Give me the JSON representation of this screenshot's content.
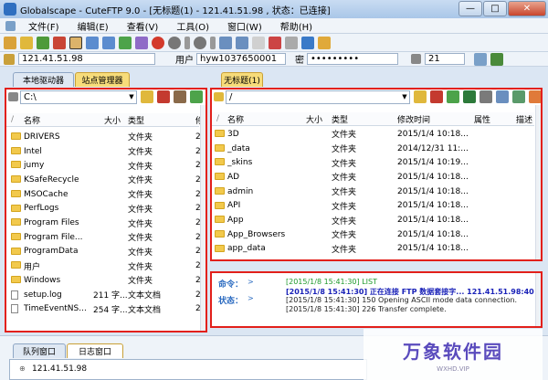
{
  "window": {
    "title": "Globalscape - CuteFTP 9.0 - [无标题(1) - 121.41.51.98 , 状态：已连接]",
    "min": "—",
    "max": "□",
    "close": "✕"
  },
  "menu": [
    "文件(F)",
    "编辑(E)",
    "查看(V)",
    "工具(O)",
    "窗口(W)",
    "帮助(H)"
  ],
  "connection": {
    "host_value": "121.41.51.98",
    "user_label": "用户",
    "user_value": "hyw1037650001",
    "pass_label": "密",
    "pass_value": "•••••••••",
    "port_value": "21"
  },
  "left_tabs": [
    "本地驱动器",
    "站点管理器"
  ],
  "right_tab": "无标题(1)",
  "local": {
    "path": "C:\\",
    "columns": [
      "名称",
      "大小",
      "类型",
      "修"
    ],
    "rows": [
      {
        "name": "DRIVERS",
        "size": "",
        "type": "文件夹",
        "mod": "2",
        "kind": "folder"
      },
      {
        "name": "Intel",
        "size": "",
        "type": "文件夹",
        "mod": "2",
        "kind": "folder"
      },
      {
        "name": "jumy",
        "size": "",
        "type": "文件夹",
        "mod": "2",
        "kind": "folder"
      },
      {
        "name": "KSafeRecycle",
        "size": "",
        "type": "文件夹",
        "mod": "2",
        "kind": "folder"
      },
      {
        "name": "MSOCache",
        "size": "",
        "type": "文件夹",
        "mod": "2",
        "kind": "folder"
      },
      {
        "name": "PerfLogs",
        "size": "",
        "type": "文件夹",
        "mod": "2",
        "kind": "folder"
      },
      {
        "name": "Program Files",
        "size": "",
        "type": "文件夹",
        "mod": "2",
        "kind": "folder"
      },
      {
        "name": "Program File...",
        "size": "",
        "type": "文件夹",
        "mod": "2",
        "kind": "folder"
      },
      {
        "name": "ProgramData",
        "size": "",
        "type": "文件夹",
        "mod": "2",
        "kind": "folder"
      },
      {
        "name": "用户",
        "size": "",
        "type": "文件夹",
        "mod": "2",
        "kind": "folder"
      },
      {
        "name": "Windows",
        "size": "",
        "type": "文件夹",
        "mod": "2",
        "kind": "folder"
      },
      {
        "name": "setup.log",
        "size": "211 字...",
        "type": "文本文档",
        "mod": "2",
        "kind": "file"
      },
      {
        "name": "TimeEventNS...",
        "size": "254 字...",
        "type": "文本文档",
        "mod": "2",
        "kind": "file"
      }
    ]
  },
  "remote": {
    "path": "/",
    "columns": [
      "名称",
      "大小",
      "类型",
      "修改时间",
      "属性",
      "描述"
    ],
    "rows": [
      {
        "name": "3D",
        "type": "文件夹",
        "mod": "2015/1/4 10:18..."
      },
      {
        "name": "_data",
        "type": "文件夹",
        "mod": "2014/12/31 11:..."
      },
      {
        "name": "_skins",
        "type": "文件夹",
        "mod": "2015/1/4 10:19..."
      },
      {
        "name": "AD",
        "type": "文件夹",
        "mod": "2015/1/4 10:18..."
      },
      {
        "name": "admin",
        "type": "文件夹",
        "mod": "2015/1/4 10:18..."
      },
      {
        "name": "API",
        "type": "文件夹",
        "mod": "2015/1/4 10:18..."
      },
      {
        "name": "App",
        "type": "文件夹",
        "mod": "2015/1/4 10:18..."
      },
      {
        "name": "App_Browsers",
        "type": "文件夹",
        "mod": "2015/1/4 10:18..."
      },
      {
        "name": "app_data",
        "type": "文件夹",
        "mod": "2015/1/4 10:18..."
      }
    ]
  },
  "log": {
    "cmd_label": "命令：",
    "cmd_arrow": ">",
    "status_label": "状态：",
    "status_arrow": ">",
    "lines": [
      {
        "text": "[2015/1/8 15:41:30] LIST",
        "color": "#1e9a2c"
      },
      {
        "text": "[2015/1/8 15:41:30] 正在连接 FTP 数据套接字... 121.41.51.98:400",
        "color": "#1a22b8"
      },
      {
        "text": "[2015/1/8 15:41:30] 150 Opening ASCII mode data connection.",
        "color": "#222222"
      },
      {
        "text": "[2015/1/8 15:41:30] 226 Transfer complete.",
        "color": "#222222"
      }
    ]
  },
  "bottom_tabs": [
    "队列窗口",
    "日志窗口"
  ],
  "bottom_tree": "121.41.51.98",
  "watermark": {
    "text": "万象软件园",
    "sub": "WXHD.VIP"
  },
  "colors": {
    "highlight": "#e2201b",
    "folder": "#f2c94c"
  }
}
